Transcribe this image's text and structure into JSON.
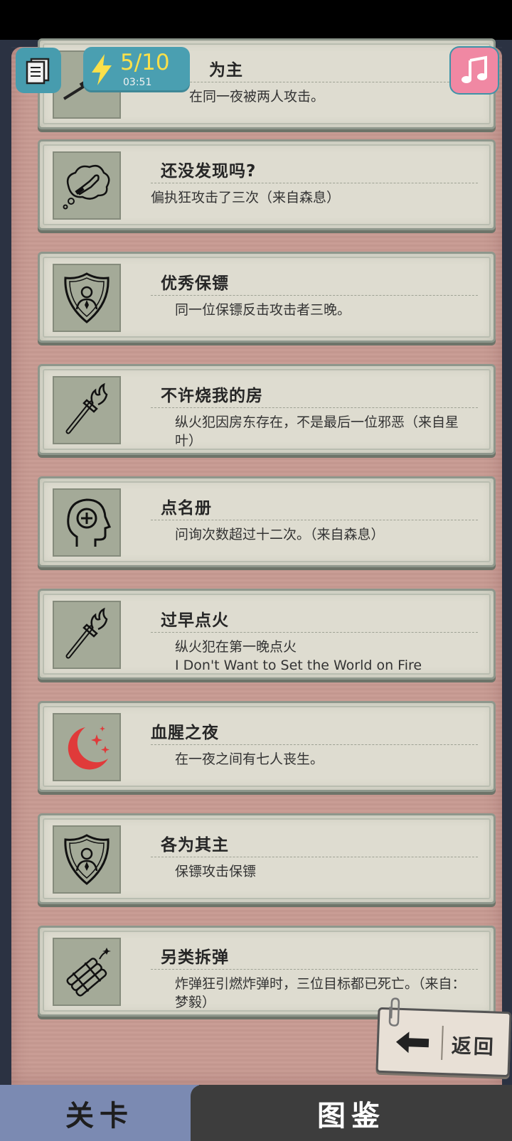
{
  "hud": {
    "energy_count": "5/10",
    "energy_timer": "03:51"
  },
  "achievements": [
    {
      "title": "为主",
      "desc": "在同一夜被两人攻击。",
      "icon": "sniper-rifle-icon"
    },
    {
      "title": "还没发现吗?",
      "desc": "偏执狂攻击了三次（来自森息）",
      "icon": "thought-knife-icon"
    },
    {
      "title": "优秀保镖",
      "desc": "同一位保镖反击攻击者三晚。",
      "icon": "bodyguard-shield-icon"
    },
    {
      "title": "不许烧我的房",
      "desc": "纵火犯因房东存在，不是最后一位邪恶（来自星叶）",
      "icon": "torch-icon"
    },
    {
      "title": "点名册",
      "desc": "问询次数超过十二次。（来自森息）",
      "icon": "head-plus-icon"
    },
    {
      "title": "过早点火",
      "desc": "纵火犯在第一晚点火\nI Don't Want to Set the World on Fire",
      "icon": "torch-icon"
    },
    {
      "title": "血腥之夜",
      "desc": "在一夜之间有七人丧生。",
      "icon": "red-moon-icon"
    },
    {
      "title": "各为其主",
      "desc": "保镖攻击保镖",
      "icon": "bodyguard-shield-icon"
    },
    {
      "title": "另类拆弹",
      "desc": "炸弹狂引燃炸弹时，三位目标都已死亡。（来自：梦毅）",
      "icon": "dynamite-icon"
    }
  ],
  "back_button": {
    "label": "返回"
  },
  "tabs": [
    {
      "label": "关卡"
    },
    {
      "label": "图鉴"
    }
  ],
  "colors": {
    "panel": "#c79a92",
    "card": "#dedcd0",
    "energy_badge": "#4a9fb1",
    "music_button": "#f088a3",
    "tab_active": "#7b8ab2",
    "tab_inactive": "#3d3d3d",
    "moon_red": "#e03a3a"
  }
}
